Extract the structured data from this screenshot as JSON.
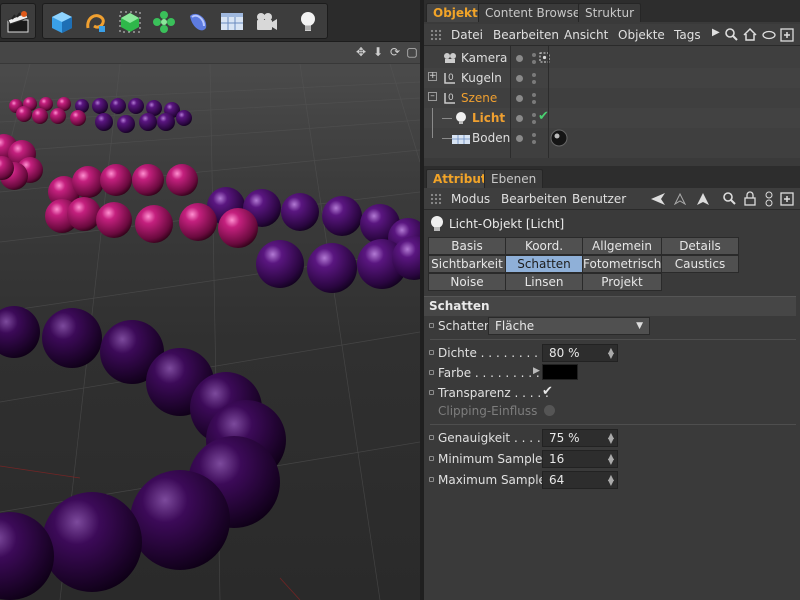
{
  "toolbar": {
    "icons": [
      "clapperboard-icon",
      "cube-icon",
      "spline-pen-icon",
      "nurbs-icon",
      "array-icon",
      "deformer-icon",
      "floor-icon",
      "camera-icon",
      "light-icon"
    ]
  },
  "viewport": {
    "header_icons": [
      "move-icon",
      "down-arrow-icon",
      "rotate-icon",
      "maximize-icon"
    ]
  },
  "objects_panel": {
    "tabs": [
      "Objekte",
      "Content Browser",
      "Struktur"
    ],
    "active_tab": "Objekte",
    "menu": [
      "Datei",
      "Bearbeiten",
      "Ansicht",
      "Objekte",
      "Tags"
    ],
    "items": [
      {
        "name": "Kamera",
        "icon": "camera-icon",
        "color": "#dedede"
      },
      {
        "name": "Kugeln",
        "icon": "null-icon",
        "color": "#dedede"
      },
      {
        "name": "Szene",
        "icon": "null-icon",
        "color": "#f0a030"
      },
      {
        "name": "Licht",
        "icon": "light-bulb-icon",
        "color": "#f0a030"
      },
      {
        "name": "Boden",
        "icon": "floor-icon",
        "color": "#dedede"
      }
    ]
  },
  "attributes_panel": {
    "tabs": [
      "Attribute",
      "Ebenen"
    ],
    "active_tab": "Attribute",
    "menu": [
      "Modus",
      "Bearbeiten",
      "Benutzer"
    ],
    "object_title": "Licht-Objekt [Licht]",
    "sub_tabs": [
      [
        "Basis",
        "Koord.",
        "Allgemein",
        "Details"
      ],
      [
        "Sichtbarkeit",
        "Schatten",
        "Fotometrisch",
        "Caustics"
      ],
      [
        "Noise",
        "Linsen",
        "Projekt"
      ]
    ],
    "active_sub_tab": "Schatten",
    "section": "Schatten",
    "schatten_label": "Schatten",
    "schatten_value": "Fläche",
    "dichte_label": "Dichte . . . . . . . . . . .",
    "dichte_value": "80 %",
    "farbe_label": "Farbe . . . . . . . . . .",
    "farbe_value": "#000000",
    "transparenz_label": "Transparenz . . . . .",
    "clipping_label": "Clipping-Einfluss",
    "genauigkeit_label": "Genauigkeit . . . . . .",
    "genauigkeit_value": "75 %",
    "min_samples_label": "Minimum Samples",
    "min_samples_value": "16",
    "max_samples_label": "Maximum Samples",
    "max_samples_value": "64"
  },
  "colors": {
    "accent_orange": "#f0a030",
    "active_subtab": "#8fb0d8",
    "sphere_magenta": "#b0186e",
    "sphere_purple": "#4a0a66"
  }
}
